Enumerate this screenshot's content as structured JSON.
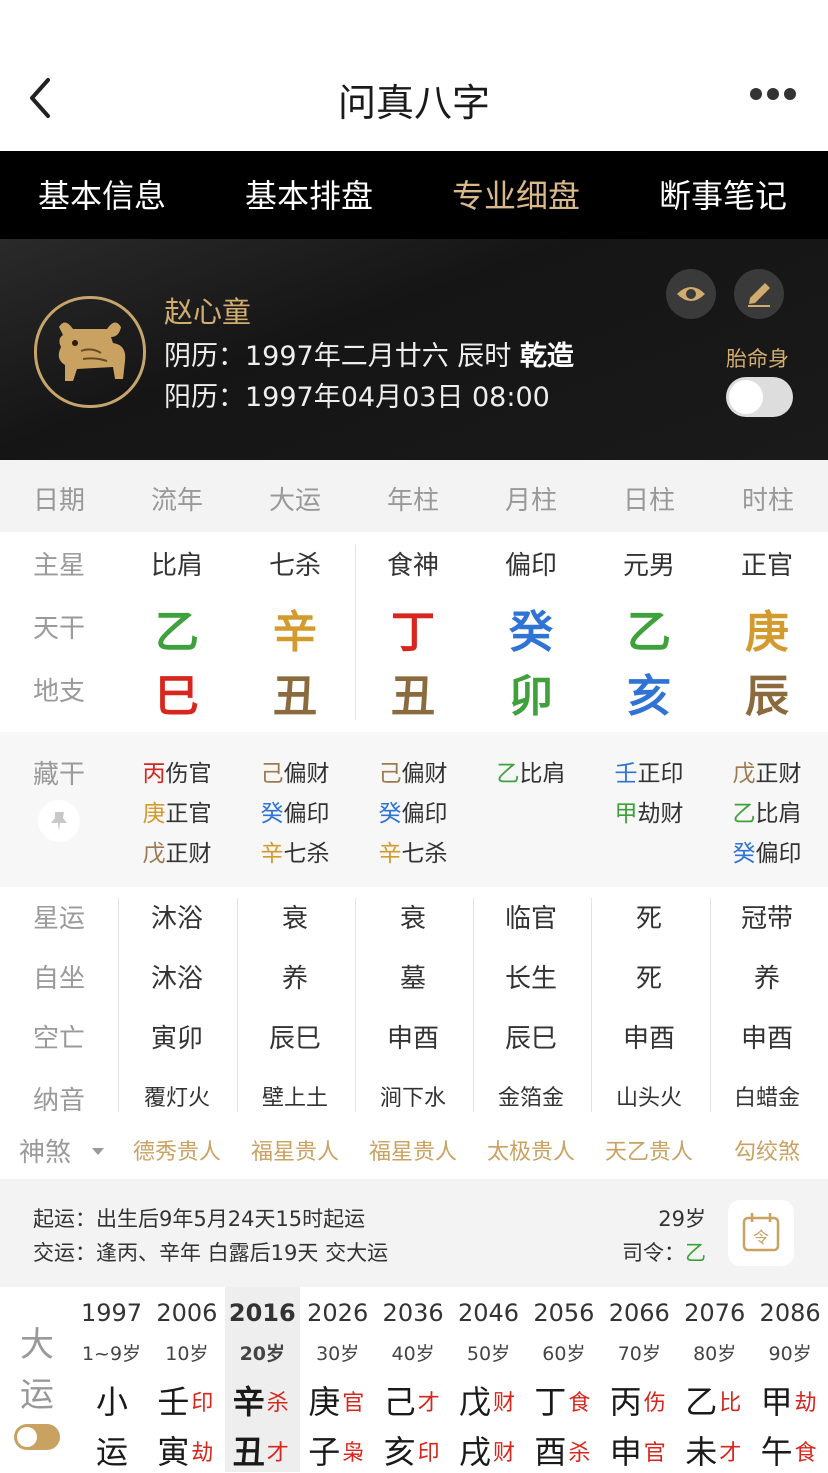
{
  "header": {
    "title": "问真八字"
  },
  "tabs": [
    {
      "label": "基本信息",
      "active": false
    },
    {
      "label": "基本排盘",
      "active": false
    },
    {
      "label": "专业细盘",
      "active": true
    },
    {
      "label": "断事笔记",
      "active": false
    }
  ],
  "profile": {
    "name": "赵心童",
    "lunar_label": "阴历：",
    "lunar": "1997年二月廿六 辰时",
    "gender": "乾造",
    "solar_label": "阳历：",
    "solar": "1997年04月03日 08:00",
    "taiming_label": "胎命身",
    "taiming_on": false
  },
  "columns": [
    "日期",
    "流年",
    "大运",
    "年柱",
    "月柱",
    "日柱",
    "时柱"
  ],
  "rows": {
    "zhuxing": {
      "label": "主星",
      "values": [
        "比肩",
        "七杀",
        "食神",
        "偏印",
        "元男",
        "正官"
      ]
    },
    "tiangan": {
      "label": "天干",
      "values": [
        {
          "char": "乙",
          "color": "#3fa13b"
        },
        {
          "char": "辛",
          "color": "#d39a2e"
        },
        {
          "char": "丁",
          "color": "#d7261e"
        },
        {
          "char": "癸",
          "color": "#2f73d4"
        },
        {
          "char": "乙",
          "color": "#3fa13b"
        },
        {
          "char": "庚",
          "color": "#d39a2e"
        }
      ]
    },
    "dizhi": {
      "label": "地支",
      "values": [
        {
          "char": "巳",
          "color": "#d7261e"
        },
        {
          "char": "丑",
          "color": "#8b6a3e"
        },
        {
          "char": "丑",
          "color": "#8b6a3e"
        },
        {
          "char": "卯",
          "color": "#3fa13b"
        },
        {
          "char": "亥",
          "color": "#2f73d4"
        },
        {
          "char": "辰",
          "color": "#8b6a3e"
        }
      ]
    }
  },
  "canggan": {
    "label": "藏干",
    "columns": [
      [
        {
          "g": "丙",
          "s": "伤官",
          "c": "#d7261e"
        },
        {
          "g": "庚",
          "s": "正官",
          "c": "#d39a2e"
        },
        {
          "g": "戊",
          "s": "正财",
          "c": "#9c7a50"
        }
      ],
      [
        {
          "g": "己",
          "s": "偏财",
          "c": "#9c7a50"
        },
        {
          "g": "癸",
          "s": "偏印",
          "c": "#2f73d4"
        },
        {
          "g": "辛",
          "s": "七杀",
          "c": "#d39a2e"
        }
      ],
      [
        {
          "g": "己",
          "s": "偏财",
          "c": "#9c7a50"
        },
        {
          "g": "癸",
          "s": "偏印",
          "c": "#2f73d4"
        },
        {
          "g": "辛",
          "s": "七杀",
          "c": "#d39a2e"
        }
      ],
      [
        {
          "g": "乙",
          "s": "比肩",
          "c": "#3fa13b"
        }
      ],
      [
        {
          "g": "壬",
          "s": "正印",
          "c": "#2f73d4"
        },
        {
          "g": "甲",
          "s": "劫财",
          "c": "#3fa13b"
        }
      ],
      [
        {
          "g": "戊",
          "s": "正财",
          "c": "#9c7a50"
        },
        {
          "g": "乙",
          "s": "比肩",
          "c": "#3fa13b"
        },
        {
          "g": "癸",
          "s": "偏印",
          "c": "#2f73d4"
        }
      ]
    ]
  },
  "lower": {
    "xingyun": {
      "label": "星运",
      "values": [
        "沐浴",
        "衰",
        "衰",
        "临官",
        "死",
        "冠带"
      ]
    },
    "zizuo": {
      "label": "自坐",
      "values": [
        "沐浴",
        "养",
        "墓",
        "长生",
        "死",
        "养"
      ]
    },
    "kongwang": {
      "label": "空亡",
      "values": [
        "寅卯",
        "辰巳",
        "申酉",
        "辰巳",
        "申酉",
        "申酉"
      ]
    },
    "nayin": {
      "label": "纳音",
      "values": [
        "覆灯火",
        "壁上土",
        "涧下水",
        "金箔金",
        "山头火",
        "白蜡金"
      ]
    },
    "shensha": {
      "label": "神煞",
      "values": [
        "德秀贵人",
        "福星贵人",
        "福星贵人",
        "太极贵人",
        "天乙贵人",
        "勾绞煞"
      ]
    }
  },
  "info": {
    "qiyun_label": "起运：",
    "qiyun": "出生后9年5月24天15时起运",
    "jiaoyun_label": "交运：",
    "jiaoyun": "逢丙、辛年 白露后19天 交大运",
    "age": "29岁",
    "siling_label": "司令：",
    "siling": "乙",
    "siling_color": "#3fa13b"
  },
  "dayun": {
    "label_top": "大",
    "label_bottom": "运",
    "toggle_on": true,
    "columns": [
      {
        "year": "1997",
        "age": "1~9岁",
        "top": "小",
        "top_shen": "",
        "top_color": "#d7261e",
        "bottom": "运",
        "bottom_shen": "",
        "bottom_color": "#d7261e",
        "selected": false
      },
      {
        "year": "2006",
        "age": "10岁",
        "top": "壬",
        "top_shen": "印",
        "top_color": "#d7261e",
        "bottom": "寅",
        "bottom_shen": "劫",
        "bottom_color": "#d7261e",
        "selected": false
      },
      {
        "year": "2016",
        "age": "20岁",
        "top": "辛",
        "top_shen": "杀",
        "top_color": "#d7261e",
        "bottom": "丑",
        "bottom_shen": "才",
        "bottom_color": "#d7261e",
        "selected": true
      },
      {
        "year": "2026",
        "age": "30岁",
        "top": "庚",
        "top_shen": "官",
        "top_color": "#d7261e",
        "bottom": "子",
        "bottom_shen": "枭",
        "bottom_color": "#d7261e",
        "selected": false
      },
      {
        "year": "2036",
        "age": "40岁",
        "top": "己",
        "top_shen": "才",
        "top_color": "#d7261e",
        "bottom": "亥",
        "bottom_shen": "印",
        "bottom_color": "#d7261e",
        "selected": false
      },
      {
        "year": "2046",
        "age": "50岁",
        "top": "戊",
        "top_shen": "财",
        "top_color": "#d7261e",
        "bottom": "戌",
        "bottom_shen": "财",
        "bottom_color": "#d7261e",
        "selected": false
      },
      {
        "year": "2056",
        "age": "60岁",
        "top": "丁",
        "top_shen": "食",
        "top_color": "#d7261e",
        "bottom": "酉",
        "bottom_shen": "杀",
        "bottom_color": "#d7261e",
        "selected": false
      },
      {
        "year": "2066",
        "age": "70岁",
        "top": "丙",
        "top_shen": "伤",
        "top_color": "#d7261e",
        "bottom": "申",
        "bottom_shen": "官",
        "bottom_color": "#d7261e",
        "selected": false
      },
      {
        "year": "2076",
        "age": "80岁",
        "top": "乙",
        "top_shen": "比",
        "top_color": "#d7261e",
        "bottom": "未",
        "bottom_shen": "才",
        "bottom_color": "#d7261e",
        "selected": false
      },
      {
        "year": "2086",
        "age": "90岁",
        "top": "甲",
        "top_shen": "劫",
        "top_color": "#d7261e",
        "bottom": "午",
        "bottom_shen": "食",
        "bottom_color": "#d7261e",
        "selected": false
      }
    ]
  }
}
